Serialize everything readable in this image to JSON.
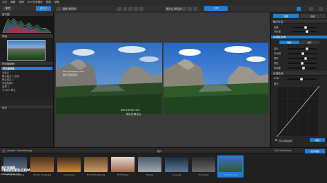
{
  "menubar": {
    "items": [
      "文件",
      "编辑",
      "图像",
      "DxO光学模块",
      "视图",
      "帮助"
    ]
  },
  "toolbar": {
    "organize_tab": "整理",
    "customize_tab": "自定义",
    "before_label": "原始图片 (修正前)",
    "after_label": "修正后 (修正后)",
    "process_button": "处理",
    "accent": "#1e7fd6"
  },
  "left_panel": {
    "histogram_title": "直方图",
    "preview_title": "导航",
    "presets_title": "预设编辑器",
    "presets_header": "预设编辑器",
    "preset_items": [
      "无校正",
      "默认校正 1 自动",
      "默认校正 2",
      "中性色调 1",
      "自然 1",
      "无 DxO 默认"
    ],
    "history_title": "历史"
  },
  "viewer": {
    "before_badge": "原始 (修正前)",
    "after_badge": "修正后 (修正后)",
    "watermark_text_1": "bbs.photops.com",
    "watermark_text_2": "照片处理论坛",
    "watermark_text_3": "bbs.16xx8.com",
    "watermark_text_4": "照片处理论坛"
  },
  "right_panel": {
    "tab_light": "光线",
    "tab_color": "色彩",
    "section_exposure": "曝光补偿",
    "row_brightness": "亮度",
    "row_contrast": "对比度",
    "section_light": "选择性色调",
    "sub_tab_1": "明暗",
    "sub_tab_2": "细节",
    "rows": [
      "高光",
      "中间调",
      "阴影",
      "黑色"
    ],
    "vibrancy": "饱和度",
    "curve_title": "色调曲线",
    "channel_label": "RGB",
    "gamma_label": "伽马",
    "bottom_checkbox": "显示原始曲线",
    "bottom_button": "重置",
    "accent": "#1e7fd6"
  },
  "strip_bar": {
    "path": "sample › Yosemite.jpg",
    "center_label": "胶片",
    "right_label_1": "DxO Collection",
    "right_label_2": "胶片视图"
  },
  "thumbnails": [
    {
      "caption": "Screen Image.jpg",
      "colors": [
        "#2a3a55",
        "#6a7a8a"
      ]
    },
    {
      "caption": "Screen Image.jpg",
      "colors": [
        "#50301a",
        "#b07a40"
      ]
    },
    {
      "caption": "sunset.jpg",
      "colors": [
        "#3a2a1a",
        "#d08a3a"
      ]
    },
    {
      "caption": "Market Bridge.jpg",
      "colors": [
        "#6a4a2a",
        "#c89a6a"
      ]
    },
    {
      "caption": "Portrait.jpg",
      "colors": [
        "#e8d8d0",
        "#a06a50"
      ]
    },
    {
      "caption": "Sky.jpg",
      "colors": [
        "#4a5a6a",
        "#a0a8b0"
      ]
    },
    {
      "caption": "Lake.jpg",
      "colors": [
        "#1a2a3a",
        "#5a7a9a"
      ]
    },
    {
      "caption": "Street.jpg",
      "colors": [
        "#2a2a2a",
        "#6a6a6a"
      ]
    },
    {
      "caption": "Yosemite.jpg",
      "colors": [
        "#3a70c0",
        "#2e5a2e"
      ]
    }
  ],
  "footer_watermark": {
    "line1": "照片处理网",
    "line2": "PHOTOPS.COM",
    "line3": "www.photops.com"
  }
}
